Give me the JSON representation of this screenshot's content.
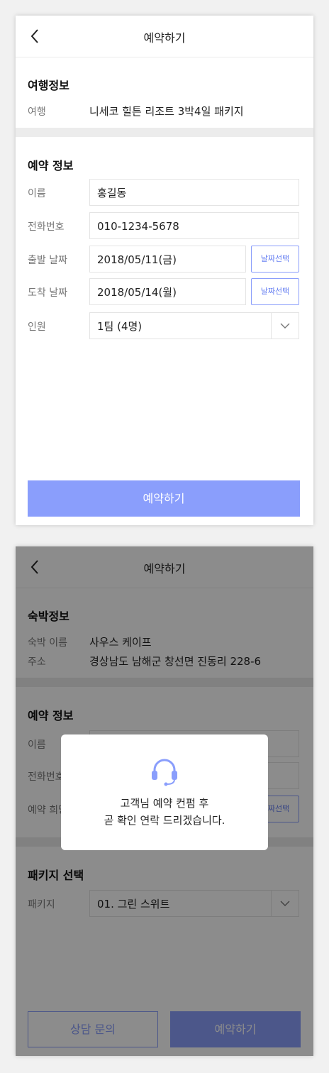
{
  "screen1": {
    "title": "예약하기",
    "trip_section": {
      "heading": "여행정보",
      "label": "여행",
      "value": "니세코 힐튼 리조트 3박4일 패키지"
    },
    "reservation_section": {
      "heading": "예약 정보",
      "name_label": "이름",
      "name_value": "홍길동",
      "phone_label": "전화번호",
      "phone_value": "010-1234-5678",
      "depart_label": "출발 날짜",
      "depart_value": "2018/05/11(금)",
      "arrive_label": "도착 날짜",
      "arrive_value": "2018/05/14(월)",
      "date_button": "날짜선택",
      "people_label": "인원",
      "people_value": "1팀 (4명)"
    },
    "submit_label": "예약하기"
  },
  "screen2": {
    "title": "예약하기",
    "stay_section": {
      "heading": "숙박정보",
      "stay_name_label": "숙박 이름",
      "stay_name_value": "사우스 케이프",
      "address_label": "주소",
      "address_value": "경상남도 남해군 창선면 진동리 228-6"
    },
    "reservation_section": {
      "heading": "예약 정보",
      "name_label": "이름",
      "phone_label": "전화번호",
      "hope_label": "예약 희망일",
      "date_button": "날짜선택"
    },
    "package_section": {
      "heading": "패키지 선택",
      "label": "패키지",
      "value": "01. 그린 스위트"
    },
    "consult_label": "상담 문의",
    "submit_label": "예약하기",
    "dialog": {
      "icon": "headset-icon",
      "line1": "고객님 예약 컨펌 후",
      "line2": "곧 확인 연락 드리겠습니다."
    }
  },
  "colors": {
    "accent": "#8a9efc",
    "accent_text": "#6a82f2",
    "divider": "#ececec"
  }
}
